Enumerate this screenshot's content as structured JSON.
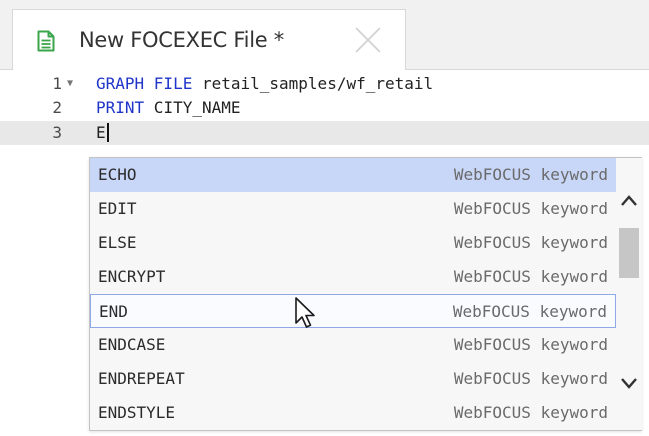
{
  "tab": {
    "title": "New FOCEXEC File *",
    "icon": "document-icon",
    "close_icon": "close-icon"
  },
  "editor": {
    "lines": [
      {
        "number": "1",
        "keyword": "GRAPH FILE",
        "rest": " retail_samples/wf_retail",
        "folded": true
      },
      {
        "number": "2",
        "keyword": "PRINT",
        "rest": " CITY_NAME",
        "folded": false
      },
      {
        "number": "3",
        "keyword": "",
        "rest": "E",
        "folded": false
      }
    ],
    "active_line": 3
  },
  "autocomplete": {
    "items": [
      {
        "name": "ECHO",
        "desc": "WebFOCUS keyword"
      },
      {
        "name": "EDIT",
        "desc": "WebFOCUS keyword"
      },
      {
        "name": "ELSE",
        "desc": "WebFOCUS keyword"
      },
      {
        "name": "ENCRYPT",
        "desc": "WebFOCUS keyword"
      },
      {
        "name": "END",
        "desc": "WebFOCUS keyword"
      },
      {
        "name": "ENDCASE",
        "desc": "WebFOCUS keyword"
      },
      {
        "name": "ENDREPEAT",
        "desc": "WebFOCUS keyword"
      },
      {
        "name": "ENDSTYLE",
        "desc": "WebFOCUS keyword"
      }
    ],
    "selected_index": 0,
    "hovered_index": 4
  },
  "colors": {
    "keyword": "#1f35c9",
    "selected_bg": "#c8d6f8",
    "hover_border": "#8fa8e8",
    "icon_green": "#3aa54a"
  }
}
